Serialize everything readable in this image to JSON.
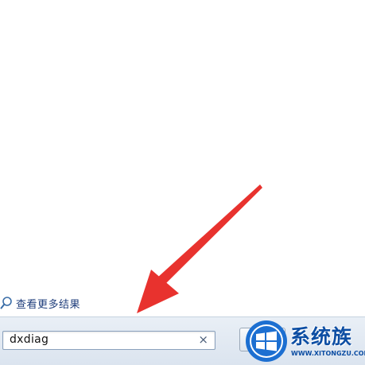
{
  "results": {
    "see_more_label": "查看更多结果",
    "see_more_icon": "search-icon"
  },
  "search": {
    "value": "dxdiag",
    "clear_glyph": "×"
  },
  "watermark": {
    "brand": "系统族",
    "url": "WWW.XITONGZU.COM"
  },
  "colors": {
    "accent_link": "#1e3d7b",
    "arrow": "#e8322e",
    "watermark": "#0d4ea3"
  }
}
